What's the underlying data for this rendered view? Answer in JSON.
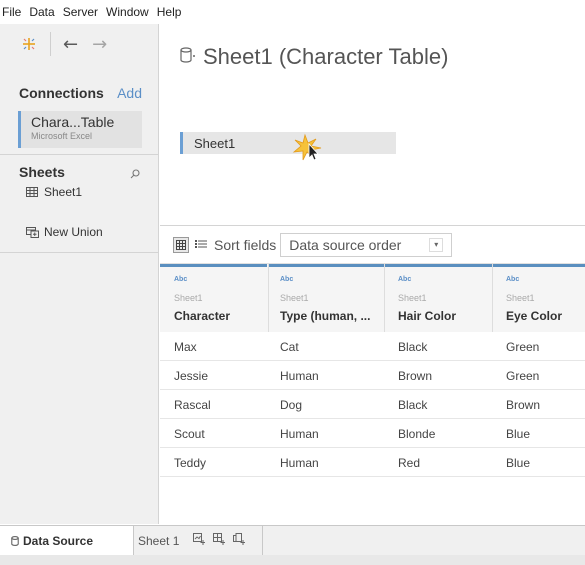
{
  "menu": [
    "File",
    "Data",
    "Server",
    "Window",
    "Help"
  ],
  "nav": {
    "back": "←",
    "forward": "→"
  },
  "connections": {
    "title": "Connections",
    "add_label": "Add",
    "item": {
      "name": "Chara...Table",
      "type": "Microsoft Excel"
    }
  },
  "sheets": {
    "title": "Sheets",
    "items": [
      "Sheet1"
    ],
    "new_union": "New Union"
  },
  "canvas": {
    "title": "Sheet1 (Character Table)",
    "table": "Sheet1"
  },
  "toolbar": {
    "sort_label": "Sort fields",
    "sort_value": "Data source order"
  },
  "grid": {
    "columns": [
      {
        "type": "Abc",
        "source": "Sheet1",
        "name": "Character"
      },
      {
        "type": "Abc",
        "source": "Sheet1",
        "name": "Type (human, ..."
      },
      {
        "type": "Abc",
        "source": "Sheet1",
        "name": "Hair Color"
      },
      {
        "type": "Abc",
        "source": "Sheet1",
        "name": "Eye Color"
      }
    ],
    "rows": [
      [
        "Max",
        "Cat",
        "Black",
        "Green"
      ],
      [
        "Jessie",
        "Human",
        "Brown",
        "Green"
      ],
      [
        "Rascal",
        "Dog",
        "Black",
        "Brown"
      ],
      [
        "Scout",
        "Human",
        "Blonde",
        "Blue"
      ],
      [
        "Teddy",
        "Human",
        "Red",
        "Blue"
      ]
    ]
  },
  "tabs": {
    "data_source": "Data Source",
    "sheet": "Sheet 1"
  },
  "colors": {
    "accent": "#6b9fd4",
    "link": "#5b8fc7",
    "panel": "#f0f0f0",
    "logo": "#e8a31e"
  }
}
